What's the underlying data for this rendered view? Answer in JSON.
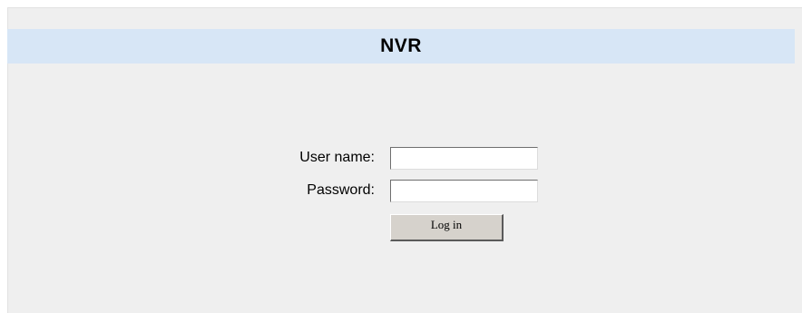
{
  "header": {
    "title": "NVR"
  },
  "login_form": {
    "username_label": "User name:",
    "username_value": "",
    "password_label": "Password:",
    "password_value": "",
    "login_button_label": "Log in"
  },
  "colors": {
    "page_background": "#ffffff",
    "panel_background": "#efefef",
    "title_bar_background": "#d7e6f6",
    "button_background": "#d6d2cc"
  }
}
